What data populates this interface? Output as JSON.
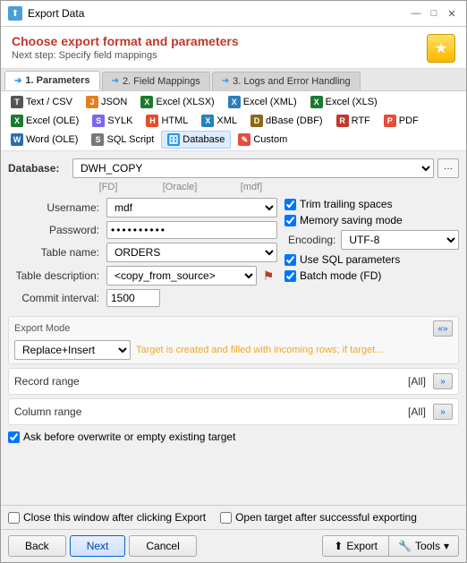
{
  "window": {
    "title": "Export Data"
  },
  "header": {
    "heading": "Choose export format and parameters",
    "subheading": "Next step: Specify field mappings"
  },
  "tabs": [
    {
      "id": "parameters",
      "label": "1. Parameters",
      "active": true
    },
    {
      "id": "field-mappings",
      "label": "2. Field Mappings",
      "active": false
    },
    {
      "id": "logs",
      "label": "3. Logs and Error Handling",
      "active": false
    }
  ],
  "formats": [
    {
      "id": "text-csv",
      "label": "Text / CSV",
      "icon": "T"
    },
    {
      "id": "json",
      "label": "JSON",
      "icon": "J"
    },
    {
      "id": "excel-xlsx",
      "label": "Excel (XLSX)",
      "icon": "X"
    },
    {
      "id": "excel-xml",
      "label": "Excel (XML)",
      "icon": "X"
    },
    {
      "id": "excel-xls",
      "label": "Excel (XLS)",
      "icon": "X"
    },
    {
      "id": "excel-ole",
      "label": "Excel (OLE)",
      "icon": "X"
    },
    {
      "id": "sylk",
      "label": "SYLK",
      "icon": "S"
    },
    {
      "id": "html",
      "label": "HTML",
      "icon": "H"
    },
    {
      "id": "xml",
      "label": "XML",
      "icon": "X"
    },
    {
      "id": "dbase-dbf",
      "label": "dBase (DBF)",
      "icon": "D"
    },
    {
      "id": "rtf",
      "label": "RTF",
      "icon": "R"
    },
    {
      "id": "pdf",
      "label": "PDF",
      "icon": "P"
    },
    {
      "id": "word-ole",
      "label": "Word (OLE)",
      "icon": "W"
    },
    {
      "id": "sql-script",
      "label": "SQL Script",
      "icon": "S"
    },
    {
      "id": "database",
      "label": "Database",
      "active": true,
      "icon": "D"
    },
    {
      "id": "custom",
      "label": "Custom",
      "icon": "C"
    }
  ],
  "form": {
    "database_label": "Database:",
    "database_value": "DWH_COPY",
    "sub_labels": [
      "[FD]",
      "[Oracle]",
      "[mdf]"
    ],
    "username_label": "Username:",
    "username_value": "mdf",
    "password_label": "Password:",
    "password_value": "••••••••••",
    "tablename_label": "Table name:",
    "tablename_value": "ORDERS",
    "table_desc_label": "Table description:",
    "table_desc_value": "<copy_from_source>",
    "commit_label": "Commit interval:",
    "commit_value": "1500",
    "trim_spaces_label": "Trim trailing spaces",
    "trim_spaces_checked": true,
    "memory_saving_label": "Memory saving mode",
    "memory_saving_checked": true,
    "encoding_label": "Encoding:",
    "encoding_value": "UTF-8",
    "use_sql_label": "Use SQL parameters",
    "use_sql_checked": true,
    "batch_mode_label": "Batch mode (FD)",
    "batch_mode_checked": true,
    "export_mode_title": "Export Mode",
    "export_mode_value": "Replace+Insert",
    "export_mode_desc": "Target is created and filled with incoming rows; if target...",
    "record_range_label": "Record range",
    "record_range_value": "[All]",
    "column_range_label": "Column range",
    "column_range_value": "[All]",
    "overwrite_check_label": "Ask before overwrite or empty existing target",
    "overwrite_checked": true
  },
  "footer": {
    "close_after_label": "Close this window after clicking Export",
    "close_after_checked": false,
    "open_target_label": "Open target after successful exporting",
    "open_target_checked": false
  },
  "buttons": {
    "back": "Back",
    "next": "Next",
    "cancel": "Cancel",
    "export": "Export",
    "tools": "Tools"
  }
}
